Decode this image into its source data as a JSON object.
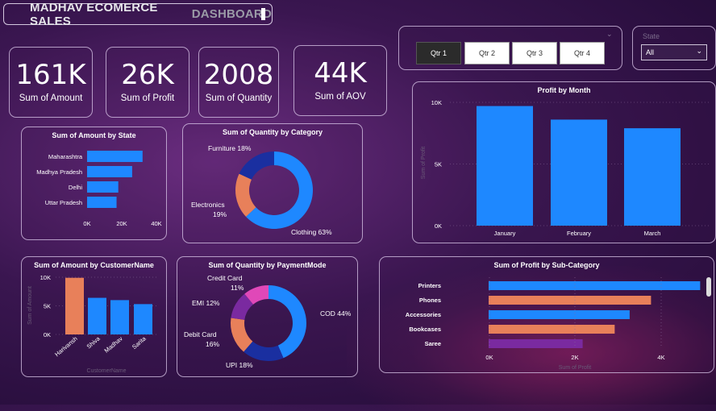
{
  "dashboard": {
    "title_part1": "MADHAV ECOMERCE SALES",
    "title_part2": "DASHBOARD"
  },
  "kpis": [
    {
      "value": "161K",
      "label": "Sum of Amount"
    },
    {
      "value": "26K",
      "label": "Sum of Profit"
    },
    {
      "value": "2008",
      "label": "Sum of Quantity"
    },
    {
      "value": "44K",
      "label": "Sum of AOV"
    }
  ],
  "quarter_slicer": {
    "buttons": [
      "Qtr 1",
      "Qtr 2",
      "Qtr 3",
      "Qtr 4"
    ],
    "selected": "Qtr 1"
  },
  "state_filter": {
    "label": "State",
    "value": "All"
  },
  "colors": {
    "blue": "#1e88ff",
    "orange": "#e8805a",
    "navy": "#1a2fa0",
    "pink": "#e048b8",
    "purple": "#7a2aa0"
  },
  "chart_data": [
    {
      "id": "amount_by_state",
      "type": "bar",
      "orientation": "horizontal",
      "title": "Sum of Amount by State",
      "categories": [
        "Maharashtra",
        "Madhya Pradesh",
        "Delhi",
        "Uttar Pradesh"
      ],
      "values": [
        32000,
        26000,
        18000,
        17000
      ],
      "xlim": [
        0,
        40000
      ],
      "ticks": [
        "0K",
        "20K",
        "40K"
      ],
      "ylabel": "",
      "xlabel": ""
    },
    {
      "id": "quantity_by_category",
      "type": "pie",
      "donut": true,
      "title": "Sum of Quantity by Category",
      "labels": [
        "Clothing",
        "Electronics",
        "Furniture"
      ],
      "values": [
        63,
        19,
        18
      ],
      "display_labels": [
        "Clothing 63%",
        "Electronics",
        "Furniture 18%"
      ],
      "display_sub": [
        "",
        "19%",
        ""
      ]
    },
    {
      "id": "profit_by_month",
      "type": "bar",
      "title": "Profit by Month",
      "categories": [
        "January",
        "February",
        "March"
      ],
      "values": [
        9700,
        8600,
        7900
      ],
      "ylim": [
        0,
        10000
      ],
      "ticks": [
        "0K",
        "5K",
        "10K"
      ],
      "ylabel": "Sum of Profit"
    },
    {
      "id": "amount_by_customer",
      "type": "bar",
      "title": "Sum of Amount by CustomerName",
      "categories": [
        "Harivansh",
        "Shiva",
        "Madhav",
        "Sarita"
      ],
      "values": [
        9900,
        6400,
        6000,
        5300
      ],
      "ylim": [
        0,
        10000
      ],
      "ticks": [
        "0K",
        "5K",
        "10K"
      ],
      "ylabel": "Sum of Amount",
      "xlabel": "CustomerName"
    },
    {
      "id": "quantity_by_payment",
      "type": "pie",
      "donut": true,
      "title": "Sum of Quantity by PaymentMode",
      "labels": [
        "COD",
        "UPI",
        "Debit Card",
        "EMI",
        "Credit Card"
      ],
      "values": [
        44,
        18,
        16,
        12,
        11
      ],
      "display_labels": [
        "COD 44%",
        "UPI 18%",
        "Debit Card",
        "EMI 12%",
        "Credit Card"
      ],
      "display_sub": [
        "",
        "",
        "16%",
        "",
        "11%"
      ]
    },
    {
      "id": "profit_by_subcategory",
      "type": "bar",
      "orientation": "horizontal",
      "title": "Sum of Profit by Sub-Category",
      "categories": [
        "Printers",
        "Phones",
        "Accessories",
        "Bookcases",
        "Saree"
      ],
      "values": [
        4950,
        3800,
        3300,
        2950,
        2200
      ],
      "xlim": [
        0,
        5000
      ],
      "ticks": [
        "0K",
        "2K",
        "4K"
      ],
      "xlabel": "Sum of Profit"
    }
  ]
}
